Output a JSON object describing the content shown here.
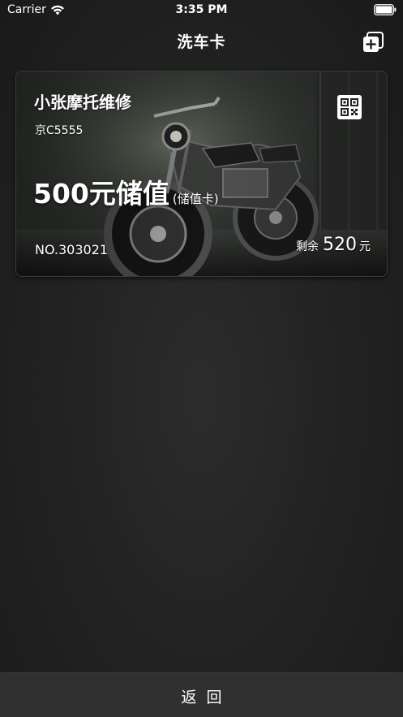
{
  "status_bar": {
    "carrier": "Carrier",
    "time": "3:35 PM"
  },
  "nav": {
    "title": "洗车卡",
    "add_icon": "add-card-icon"
  },
  "card": {
    "shop_name": "小张摩托维修",
    "plate": "京C5555",
    "amount_title": "500元储值",
    "card_type": "(储值卡)",
    "card_no": "NO.303021",
    "balance_label": "剩余",
    "balance_value": "520",
    "balance_unit": "元",
    "qr_icon": "qr-code-icon"
  },
  "bottom": {
    "back_label": "返回"
  },
  "colors": {
    "background": "#232323",
    "bottom_bar": "#303030",
    "text": "#ffffff"
  }
}
